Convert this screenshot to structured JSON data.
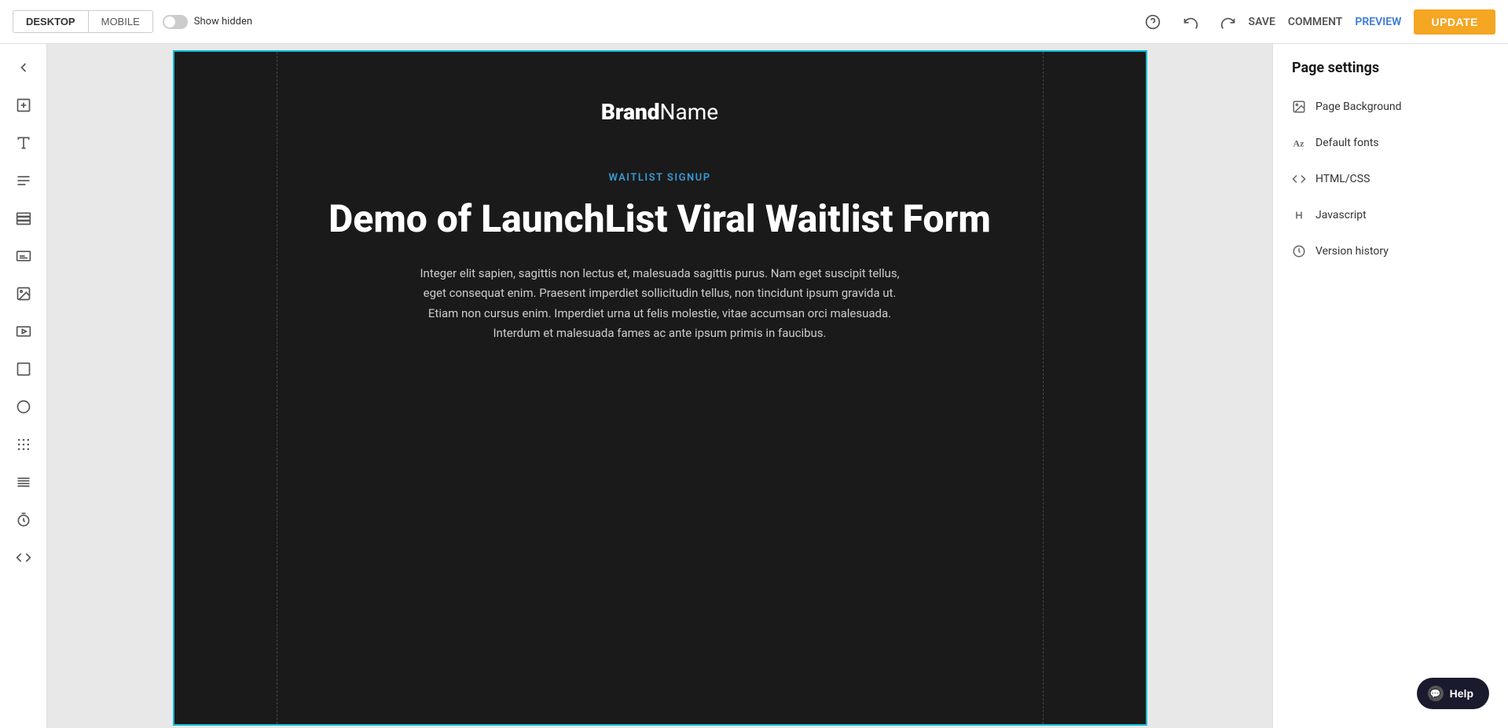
{
  "toolbar": {
    "desktop_label": "DESKTOP",
    "mobile_label": "MOBILE",
    "show_hidden_label": "Show hidden",
    "save_label": "SAVE",
    "comment_label": "COMMENT",
    "preview_label": "PREVIEW",
    "update_label": "UPDATE"
  },
  "left_sidebar": {
    "icons": [
      {
        "name": "back-icon",
        "symbol": "←"
      },
      {
        "name": "add-section-icon",
        "symbol": "⊞"
      },
      {
        "name": "text-icon",
        "symbol": "A"
      },
      {
        "name": "paragraph-icon",
        "symbol": "≡"
      },
      {
        "name": "list-icon",
        "symbol": "☰"
      },
      {
        "name": "caption-icon",
        "symbol": "⊟"
      },
      {
        "name": "image-icon",
        "symbol": "🖼"
      },
      {
        "name": "video-icon",
        "symbol": "▶"
      },
      {
        "name": "box-icon",
        "symbol": "□"
      },
      {
        "name": "circle-icon",
        "symbol": "○"
      },
      {
        "name": "dots-icon",
        "symbol": "⠿"
      },
      {
        "name": "lines-icon",
        "symbol": "⠶"
      },
      {
        "name": "timer-icon",
        "symbol": "⏱"
      },
      {
        "name": "code-icon",
        "symbol": "<>"
      }
    ]
  },
  "canvas": {
    "brand_bold": "Brand",
    "brand_light": "Name",
    "waitlist_label": "WAITLIST SIGNUP",
    "hero_title": "Demo of LaunchList Viral Waitlist Form",
    "hero_description": "Integer elit sapien, sagittis non lectus et, malesuada sagittis purus. Nam eget suscipit tellus, eget consequat enim. Praesent imperdiet sollicitudin tellus, non tincidunt ipsum gravida ut. Etiam non cursus enim. Imperdiet urna ut felis molestie, vitae accumsan orci malesuada. Interdum et malesuada fames ac ante ipsum primis in faucibus."
  },
  "right_panel": {
    "title": "Page settings",
    "items": [
      {
        "name": "page-background-item",
        "label": "Page Background",
        "icon": "image-icon"
      },
      {
        "name": "default-fonts-item",
        "label": "Default fonts",
        "icon": "az-icon"
      },
      {
        "name": "html-css-item",
        "label": "HTML/CSS",
        "icon": "code-brackets-icon"
      },
      {
        "name": "javascript-item",
        "label": "Javascript",
        "icon": "curly-braces-icon"
      },
      {
        "name": "version-history-item",
        "label": "Version history",
        "icon": "clock-icon"
      }
    ]
  },
  "help": {
    "label": "Help"
  }
}
